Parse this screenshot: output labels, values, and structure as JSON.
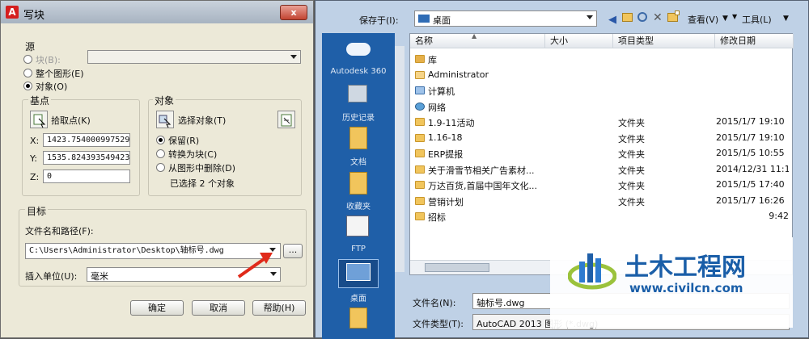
{
  "write_block": {
    "title": "写块",
    "close_glyph": "x",
    "source": {
      "label": "源",
      "block_radio": "块(B):",
      "whole_radio": "整个图形(E)",
      "objects_radio": "对象(O)"
    },
    "base_point": {
      "label": "基点",
      "pick_button": "拾取点(K)",
      "x_label": "X:",
      "x_value": "1423.754000997529",
      "y_label": "Y:",
      "y_value": "1535.824393549423",
      "z_label": "Z:",
      "z_value": "0"
    },
    "objects": {
      "label": "对象",
      "select_button": "选择对象(T)",
      "retain": "保留(R)",
      "convert": "转换为块(C)",
      "delete": "从图形中删除(D)",
      "selected_text": "已选择 2 个对象"
    },
    "destination": {
      "label": "目标",
      "path_label": "文件名和路径(F):",
      "path_value": "C:\\Users\\Administrator\\Desktop\\轴标号.dwg",
      "browse": "...",
      "unit_label": "插入单位(U):",
      "unit_value": "毫米"
    },
    "buttons": {
      "ok": "确定",
      "cancel": "取消",
      "help": "帮助(H)"
    }
  },
  "save_dialog": {
    "save_in_label": "保存于(I):",
    "save_in_value": "桌面",
    "toolbar": {
      "view": "查看(V)",
      "tools": "工具(L)"
    },
    "places": [
      "Autodesk 360",
      "历史记录",
      "文档",
      "收藏夹",
      "FTP",
      "桌面"
    ],
    "columns": [
      "名称",
      "大小",
      "项目类型",
      "修改日期"
    ],
    "rows": [
      {
        "name": "库",
        "type": "",
        "date": "",
        "icon": "library-icon"
      },
      {
        "name": "Administrator",
        "type": "",
        "date": "",
        "icon": "user-folder-icon"
      },
      {
        "name": "计算机",
        "type": "",
        "date": "",
        "icon": "computer-icon"
      },
      {
        "name": "网络",
        "type": "",
        "date": "",
        "icon": "network-icon"
      },
      {
        "name": "1.9-11活动",
        "type": "文件夹",
        "date": "2015/1/7 19:10",
        "icon": "folder-icon"
      },
      {
        "name": "1.16-18",
        "type": "文件夹",
        "date": "2015/1/7 19:10",
        "icon": "folder-icon"
      },
      {
        "name": "ERP提报",
        "type": "文件夹",
        "date": "2015/1/5 10:55",
        "icon": "folder-icon"
      },
      {
        "name": "关于滑雪节相关广告素材...",
        "type": "文件夹",
        "date": "2014/12/31 11:1",
        "icon": "folder-icon"
      },
      {
        "name": "万达百货,首届中国年文化...",
        "type": "文件夹",
        "date": "2015/1/5 17:40",
        "icon": "folder-icon"
      },
      {
        "name": "营销计划",
        "type": "文件夹",
        "date": "2015/1/7 16:26",
        "icon": "folder-icon"
      },
      {
        "name": "招标",
        "type": "",
        "date": "9:42",
        "icon": "folder-icon"
      }
    ],
    "filename_label": "文件名(N):",
    "filename_value": "轴标号.dwg",
    "filetype_label": "文件类型(T):",
    "filetype_value": "AutoCAD 2013 图形 (*.dwg)"
  },
  "watermark": {
    "brand": "土木工程网",
    "url": "www.civilcn.com"
  },
  "colors": {
    "places_bg": "#1f5fa8",
    "annotation_arrow": "#e02a1a"
  }
}
